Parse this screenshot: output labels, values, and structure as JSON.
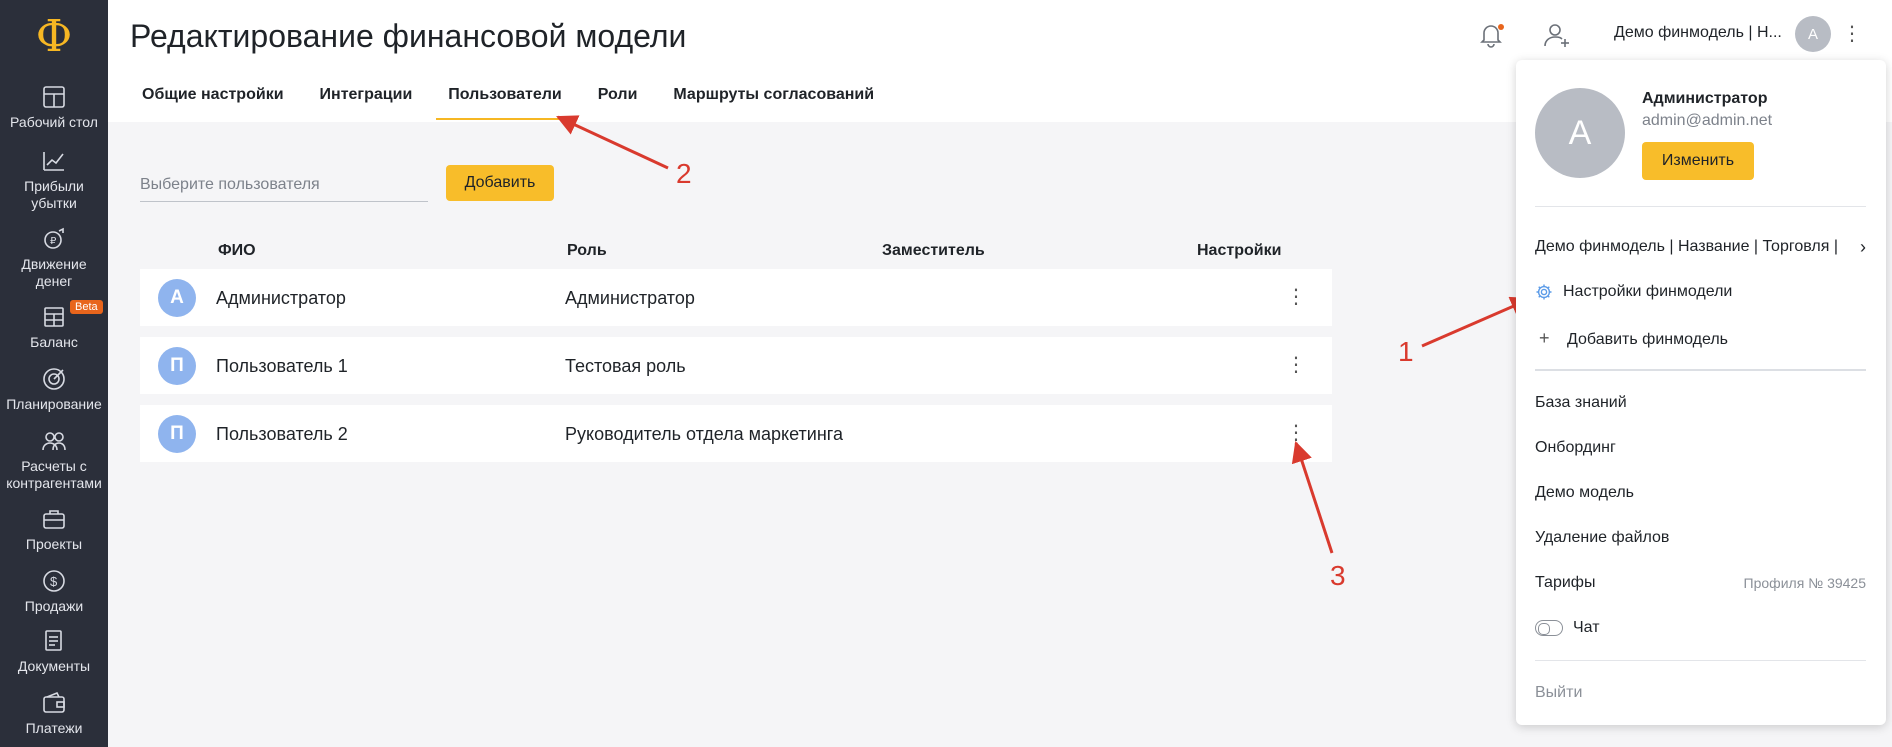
{
  "app": {
    "logo": "Ф"
  },
  "sidebar": {
    "items": [
      {
        "label": "Рабочий стол",
        "icon": "dashboard-icon"
      },
      {
        "label": "Прибыли убытки",
        "icon": "chart-icon"
      },
      {
        "label": "Движение денег",
        "icon": "cash-flow-icon"
      },
      {
        "label": "Баланс",
        "icon": "balance-icon",
        "badge": "Beta"
      },
      {
        "label": "Планирование",
        "icon": "target-icon"
      },
      {
        "label": "Расчеты с контрагентами",
        "icon": "contacts-icon"
      },
      {
        "label": "Проекты",
        "icon": "briefcase-icon"
      },
      {
        "label": "Продажи",
        "icon": "dollar-icon"
      },
      {
        "label": "Документы",
        "icon": "documents-icon"
      },
      {
        "label": "Платежи",
        "icon": "wallet-icon"
      }
    ]
  },
  "header": {
    "title": "Редактирование финансовой модели",
    "model_label": "Демо финмодель | Н...",
    "avatar_letter": "A"
  },
  "tabs": [
    {
      "label": "Общие настройки",
      "active": false
    },
    {
      "label": "Интеграции",
      "active": false
    },
    {
      "label": "Пользователи",
      "active": true
    },
    {
      "label": "Роли",
      "active": false
    },
    {
      "label": "Маршруты согласований",
      "active": false
    }
  ],
  "users_panel": {
    "search_placeholder": "Выберите пользователя",
    "add_label": "Добавить",
    "columns": [
      "ФИО",
      "Роль",
      "Заместитель",
      "Настройки"
    ],
    "rows": [
      {
        "initial": "А",
        "name": "Администратор",
        "role": "Администратор",
        "deputy": ""
      },
      {
        "initial": "П",
        "name": "Пользователь 1",
        "role": "Тестовая роль",
        "deputy": ""
      },
      {
        "initial": "П",
        "name": "Пользователь 2",
        "role": "Руководитель отдела маркетинга",
        "deputy": ""
      }
    ]
  },
  "annotations": {
    "a1": "1",
    "a2": "2",
    "a3": "3",
    "color": "#d93a2e"
  },
  "dropdown": {
    "avatar_letter": "A",
    "user_name": "Администратор",
    "user_email": "admin@admin.net",
    "edit_label": "Изменить",
    "current_model": "Демо финмодель | Название | Торговля |",
    "settings_label": "Настройки финмодели",
    "add_model_label": "Добавить финмодель",
    "links": [
      "База знаний",
      "Онбординг",
      "Демо модель",
      "Удаление файлов",
      "Тарифы"
    ],
    "profile_number": "Профиля № 39425",
    "chat_label": "Чат",
    "logout_label": "Выйти"
  },
  "colors": {
    "accent": "#f8bd2a",
    "sidebar_bg": "#2b2f3a",
    "avatar_blue": "#8fb4ee"
  }
}
